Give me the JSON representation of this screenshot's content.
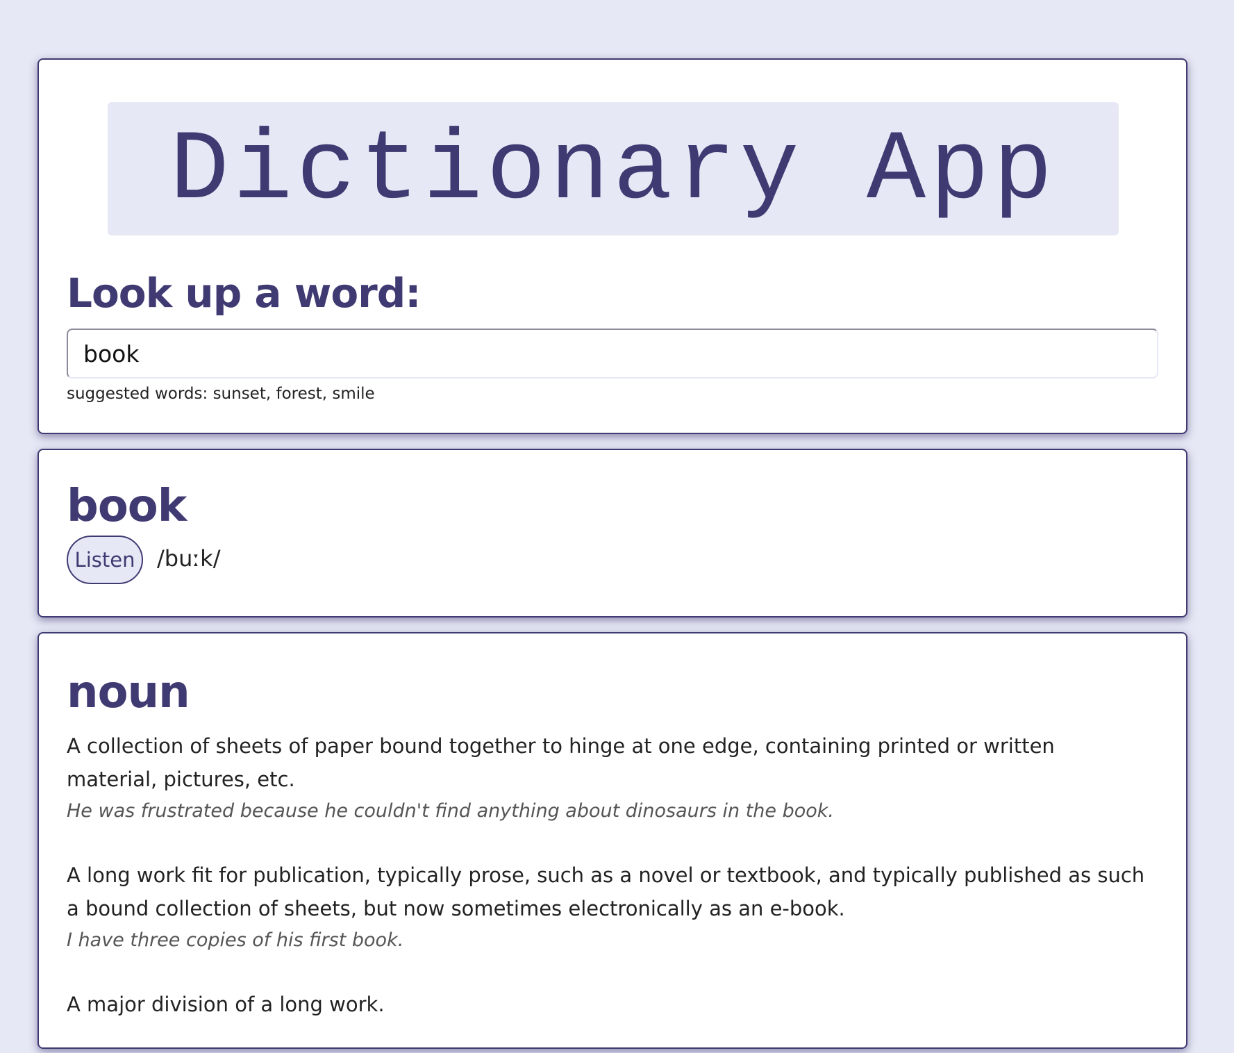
{
  "header": {
    "app_title": "Dictionary App",
    "lookup_heading": "Look up a word:"
  },
  "search": {
    "value": "book",
    "suggested_label": "suggested words:",
    "suggested_words": "sunset, forest, smile"
  },
  "word": {
    "headword": "book",
    "listen_label": "Listen",
    "phonetic": "/buːk/"
  },
  "meanings": [
    {
      "part_of_speech": "noun",
      "definitions": [
        {
          "definition": "A collection of sheets of paper bound together to hinge at one edge, containing printed or written material, pictures, etc.",
          "example": "He was frustrated because he couldn't find anything about dinosaurs in the book."
        },
        {
          "definition": "A long work fit for publication, typically prose, such as a novel or textbook, and typically published as such a bound collection of sheets, but now sometimes electronically as an e-book.",
          "example": "I have three copies of his first book."
        },
        {
          "definition": "A major division of a long work.",
          "example": ""
        }
      ]
    }
  ],
  "colors": {
    "background": "#e6e8f5",
    "accent": "#3f3a72",
    "card": "#ffffff"
  }
}
